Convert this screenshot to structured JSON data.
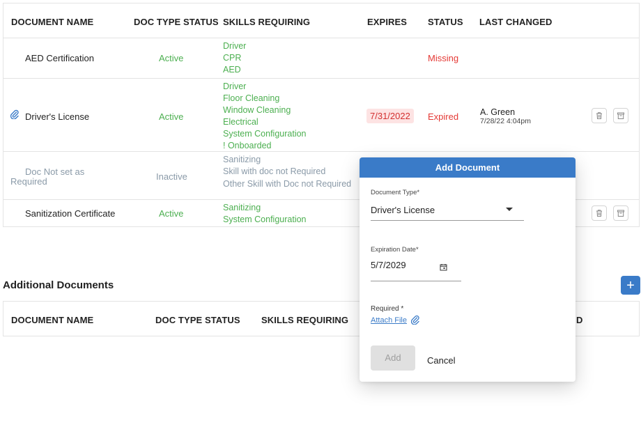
{
  "required_docs": {
    "headers": {
      "name": "DOCUMENT NAME",
      "doc_type_status": "DOC TYPE STATUS",
      "skills": "SKILLS REQUIRING",
      "expires": "EXPIRES",
      "status": "STATUS",
      "last_changed": "LAST CHANGED"
    },
    "rows": [
      {
        "name": "AED Certification",
        "doc_type_status": "Active",
        "skills": [
          "Driver",
          "CPR",
          "AED"
        ],
        "expires": "",
        "status": "Missing",
        "changed_by": "",
        "changed_at": ""
      },
      {
        "name": "Driver's License",
        "doc_type_status": "Active",
        "skills": [
          "Driver",
          "Floor Cleaning",
          "Window Cleaning",
          "Electrical",
          "System Configuration",
          "! Onboarded"
        ],
        "expires": "7/31/2022",
        "status": "Expired",
        "changed_by": "A. Green",
        "changed_at": "7/28/22 4:04pm"
      },
      {
        "name": "Doc Not set as Required",
        "doc_type_status": "Inactive",
        "skills": [
          "Sanitizing",
          "Skill with doc not Required",
          "Other Skill with Doc not Required"
        ],
        "expires": "",
        "status": "",
        "changed_by": "",
        "changed_at": ""
      },
      {
        "name": "Sanitization Certificate",
        "doc_type_status": "Active",
        "skills": [
          "Sanitizing",
          "System Configuration"
        ],
        "expires": "",
        "status": "",
        "changed_by": "",
        "changed_at": ""
      }
    ]
  },
  "additional_docs": {
    "title": "Additional Documents",
    "add_button": "+",
    "headers": {
      "name": "DOCUMENT NAME",
      "doc_type_status": "DOC TYPE STATUS",
      "skills": "SKILLS REQUIRING",
      "last_changed_partial": "D"
    }
  },
  "dialog": {
    "title": "Add Document",
    "doc_type_label": "Document Type*",
    "doc_type_value": "Driver's License",
    "exp_label": "Expiration Date*",
    "exp_value": "5/7/2029",
    "required_label": "Required *",
    "attach_label": "Attach File",
    "add_label": "Add",
    "cancel_label": "Cancel"
  },
  "colors": {
    "accent": "#3a7bc8",
    "active": "#4caf50",
    "error": "#e53935",
    "inactive": "#8a9aa8"
  }
}
